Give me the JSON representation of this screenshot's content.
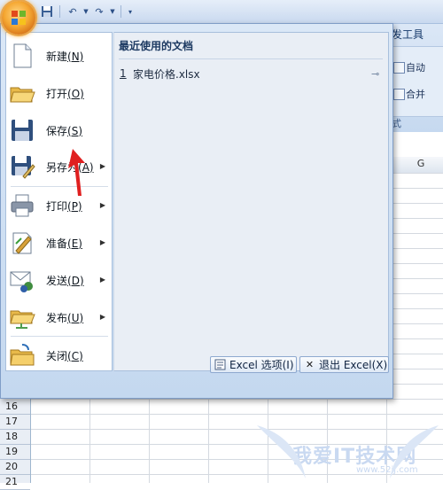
{
  "ribbon": {
    "tab_label": "发工具",
    "row1": "自动",
    "row2": "合并",
    "group_label": "式"
  },
  "sheet": {
    "column_g": "G",
    "row_numbers": [
      "16",
      "17",
      "18",
      "19",
      "20",
      "21"
    ]
  },
  "office_menu": {
    "items": [
      {
        "name": "new",
        "label": "新建",
        "key": "(N)",
        "has_submenu": false
      },
      {
        "name": "open",
        "label": "打开",
        "key": "(O)",
        "has_submenu": false
      },
      {
        "name": "save",
        "label": "保存",
        "key": "(S)",
        "has_submenu": false
      },
      {
        "name": "save-as",
        "label": "另存为",
        "key": "(A)",
        "has_submenu": true
      },
      {
        "name": "print",
        "label": "打印",
        "key": "(P)",
        "has_submenu": true
      },
      {
        "name": "prepare",
        "label": "准备",
        "key": "(E)",
        "has_submenu": true
      },
      {
        "name": "send",
        "label": "发送",
        "key": "(D)",
        "has_submenu": true
      },
      {
        "name": "publish",
        "label": "发布",
        "key": "(U)",
        "has_submenu": true
      },
      {
        "name": "close",
        "label": "关闭",
        "key": "(C)",
        "has_submenu": false
      }
    ],
    "recent": {
      "header": "最近使用的文档",
      "files": [
        {
          "num": "1",
          "name": "家电价格.xlsx"
        }
      ]
    },
    "options_button": "Excel 选项(I)",
    "exit_button": "退出 Excel(X)"
  },
  "watermark": {
    "text": "我爱IT技术网",
    "url": "www.52ij.com"
  },
  "colors": {
    "menu_bg": "#c4d8ef",
    "office_button": "#f5a833",
    "annotation_arrow": "#e02020"
  },
  "icons": [
    "office-logo-icon",
    "save-icon",
    "undo-icon",
    "redo-icon",
    "customize-qat-icon",
    "pin-icon",
    "options-icon",
    "exit-icon"
  ]
}
